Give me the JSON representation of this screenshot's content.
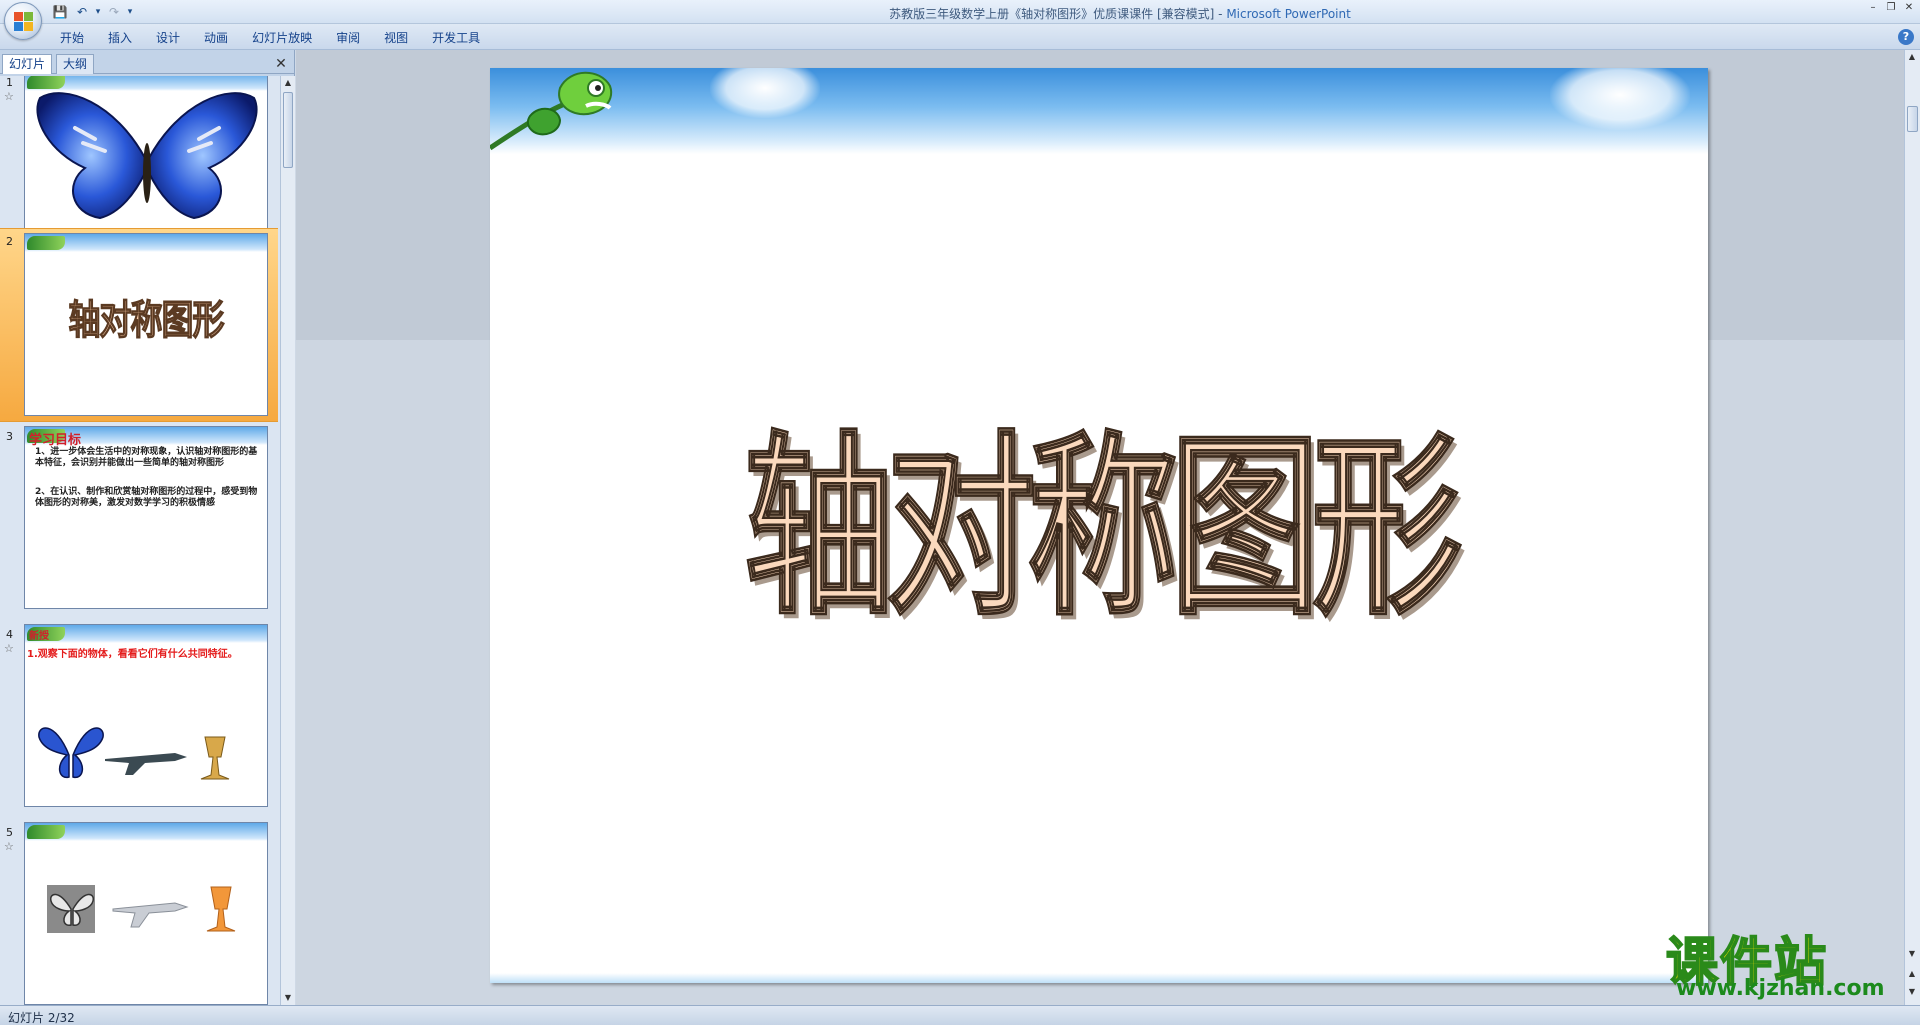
{
  "window": {
    "title_doc": "苏教版三年级数学上册《轴对称图形》优质课课件 [兼容模式] - ",
    "title_app": "Microsoft PowerPoint"
  },
  "ribbon": {
    "tabs": [
      "开始",
      "插入",
      "设计",
      "动画",
      "幻灯片放映",
      "审阅",
      "视图",
      "开发工具"
    ]
  },
  "left_panel": {
    "tabs": {
      "slides": "幻灯片",
      "outline": "大纲"
    },
    "thumbnails": [
      {
        "number": "1",
        "has_star": true
      },
      {
        "number": "2",
        "title": "轴对称图形",
        "selected": true
      },
      {
        "number": "3",
        "heading": "学习目标",
        "bullets": [
          "1、进一步体会生活中的对称现象，认识轴对称图形的基本特征，会识别并能做出一些简单的轴对称图形",
          "2、在认识、制作和欣赏轴对称图形的过程中，感受到物体图形的对称美，激发对数学学习的积极情感"
        ]
      },
      {
        "number": "4",
        "has_star": true,
        "heading": "新授",
        "text": "1.观察下面的物体，看看它们有什么共同特征。"
      },
      {
        "number": "5",
        "has_star": true
      }
    ]
  },
  "slide": {
    "title": "轴对称图形"
  },
  "status_bar": {
    "text": "幻灯片 2/32"
  },
  "watermark": {
    "title": "课件站",
    "url": "www.kjzhan.com"
  },
  "colors": {
    "selected_thumb": "#f6a940",
    "title_fill": "#fbd9bd",
    "ribbon_text": "#15428b"
  }
}
